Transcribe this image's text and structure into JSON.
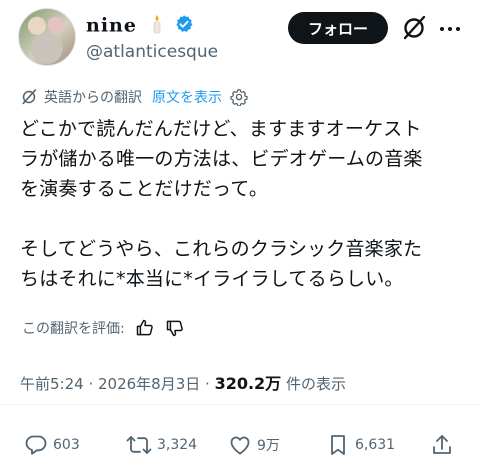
{
  "header": {
    "display_name": "nine",
    "handle": "@atlanticesque",
    "follow_label": "フォロー"
  },
  "translation": {
    "label": "英語からの翻訳",
    "show_original": "原文を表示"
  },
  "post": {
    "body": "どこかで読んだんだけど、ますますオーケスト\nラが儲かる唯一の方法は、ビデオゲームの音楽\nを演奏することだけだって。\n\nそしてどうやら、これらのクラシック音楽家た\nちはそれに*本当に*イライラしてるらしい。",
    "rate_label": "この翻訳を評価:",
    "timestamp": "午前5:24 · 2026年8月3日 · ",
    "views_count": "320.2万",
    "views_suffix": " 件の表示"
  },
  "actions": {
    "replies": "603",
    "reposts": "3,324",
    "likes": "9万",
    "bookmarks": "6,631"
  },
  "colors": {
    "text": "#0f1419",
    "muted": "#536471",
    "link": "#1d9bf0",
    "verified": "#1d9bf0"
  }
}
